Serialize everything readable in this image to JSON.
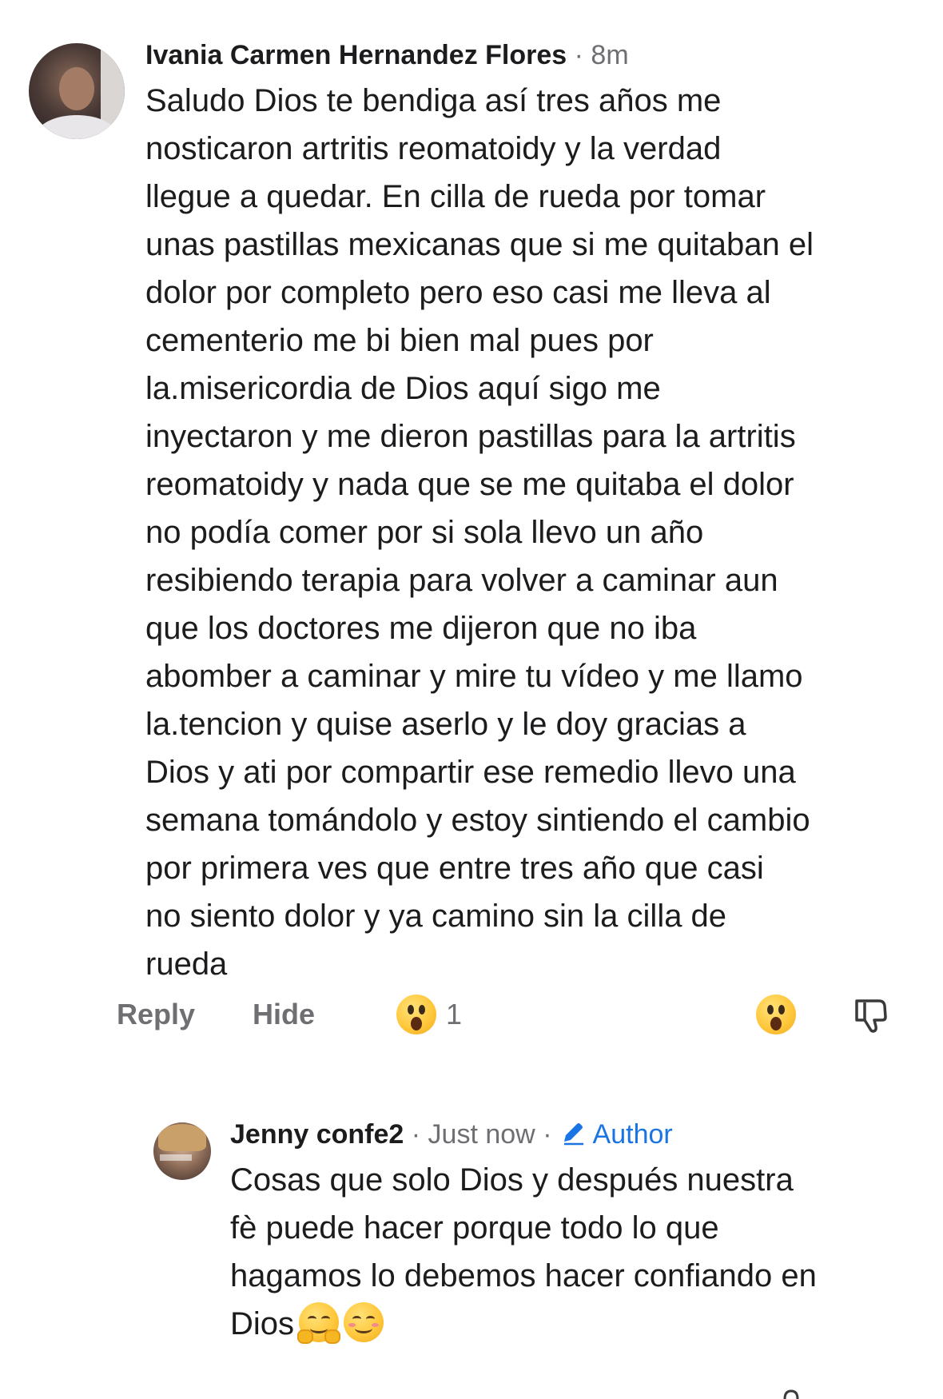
{
  "comment": {
    "author": "Ivania Carmen Hernandez Flores",
    "separator": "·",
    "time": "8m",
    "text": "Saludo Dios te bendiga así tres años me\nnosticaron artritis reomatoidy y la verdad\nllegue a quedar. En cilla de rueda por tomar\nunas pastillas mexicanas que si me quitaban el\ndolor por completo pero eso casi me lleva al\ncementerio me bi bien mal pues por\nla.misericordia de Dios aquí sigo me\ninyectaron y me dieron pastillas para la artritis\nreomatoidy y nada que se me quitaba el dolor\nno podía comer por si sola llevo un año\nresibiendo terapia para volver a caminar aun\nque los doctores me dijeron que no iba\nabomber a caminar y mire tu vídeo y me llamo\nla.tencion y quise aserlo y le doy gracias a\nDios y ati por compartir ese remedio llevo una\nsemana tomándolo y estoy sintiendo el cambio\npor primera  ves que entre tres año que casi\nno siento dolor y ya camino sin la cilla de\nrueda",
    "actions": {
      "reply_label": "Reply",
      "hide_label": "Hide",
      "reaction_icon": "surprised-face-emoji",
      "reaction_count": "1",
      "react_icon": "surprised-face-emoji",
      "dislike_icon": "thumbs-down-icon"
    }
  },
  "reply": {
    "author": "Jenny confe2",
    "separator": "·",
    "time": "Just now",
    "separator2": "·",
    "badge_icon": "pencil-icon",
    "badge_label": "Author",
    "text": "Cosas que solo Dios y después nuestra\nfè puede hacer porque todo lo que\nhagamos lo debemos hacer confiando en\nDios",
    "emojis": [
      "hugging-face-emoji",
      "smiling-face-emoji"
    ]
  },
  "colors": {
    "text": "#1c1c1e",
    "muted": "#6e6e73",
    "accent": "#1b74e4"
  }
}
